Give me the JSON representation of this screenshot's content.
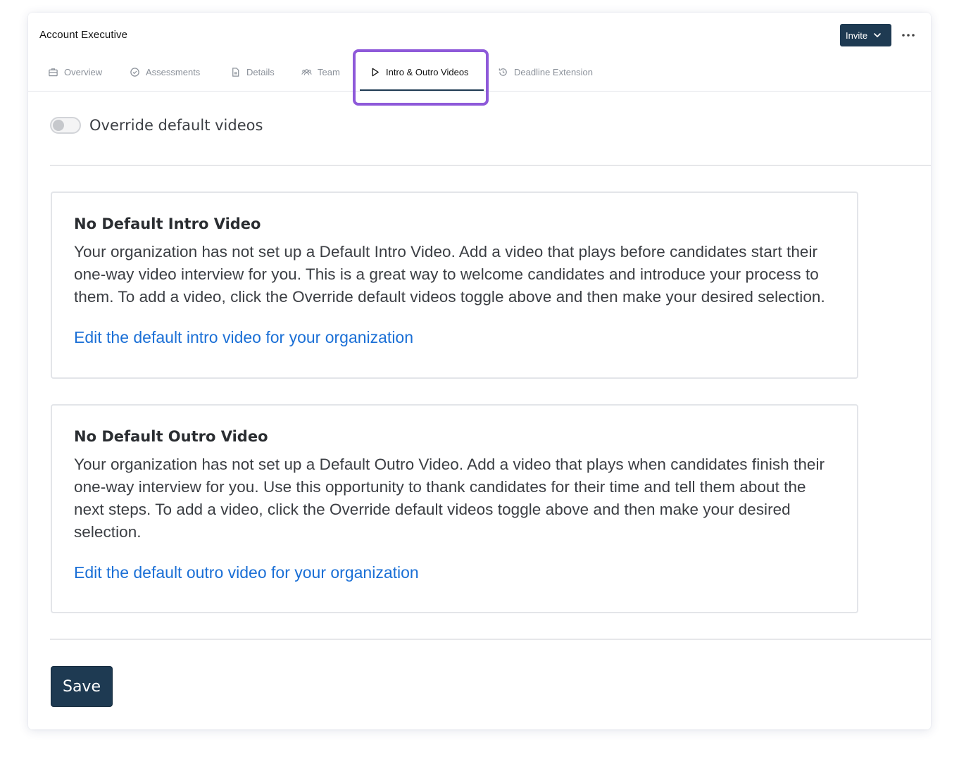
{
  "header": {
    "title": "Account Executive",
    "invite_label": "Invite"
  },
  "tabs": [
    {
      "label": "Overview",
      "icon": "briefcase-icon"
    },
    {
      "label": "Assessments",
      "icon": "check-circle-icon"
    },
    {
      "label": "Details",
      "icon": "document-icon"
    },
    {
      "label": "Team",
      "icon": "team-icon"
    },
    {
      "label": "Intro & Outro Videos",
      "icon": "play-icon",
      "active": true
    },
    {
      "label": "Deadline Extension",
      "icon": "history-icon"
    }
  ],
  "toggle": {
    "label": "Override default videos",
    "checked": false
  },
  "intro": {
    "heading": "No Default Intro Video",
    "body": "Your organization has not set up a Default Intro Video. Add a video that plays before candidates start their one-way video interview for you. This is a great way to welcome candidates and introduce your process to them. To add a video, click the Override default videos toggle above and then make your desired selection.",
    "link": "Edit the default intro video for your organization"
  },
  "outro": {
    "heading": "No Default Outro Video",
    "body": "Your organization has not set up a Default Outro Video. Add a video that plays when candidates finish their one-way interview for you. Use this opportunity to thank candidates for their time and tell them about the next steps. To add a video, click the Override default videos toggle above and then make your desired selection.",
    "link": "Edit the default outro video for your organization"
  },
  "footer": {
    "save_label": "Save"
  },
  "colors": {
    "primary": "#1e3a52",
    "link": "#1a6fd6",
    "highlight": "#8e59d9"
  }
}
